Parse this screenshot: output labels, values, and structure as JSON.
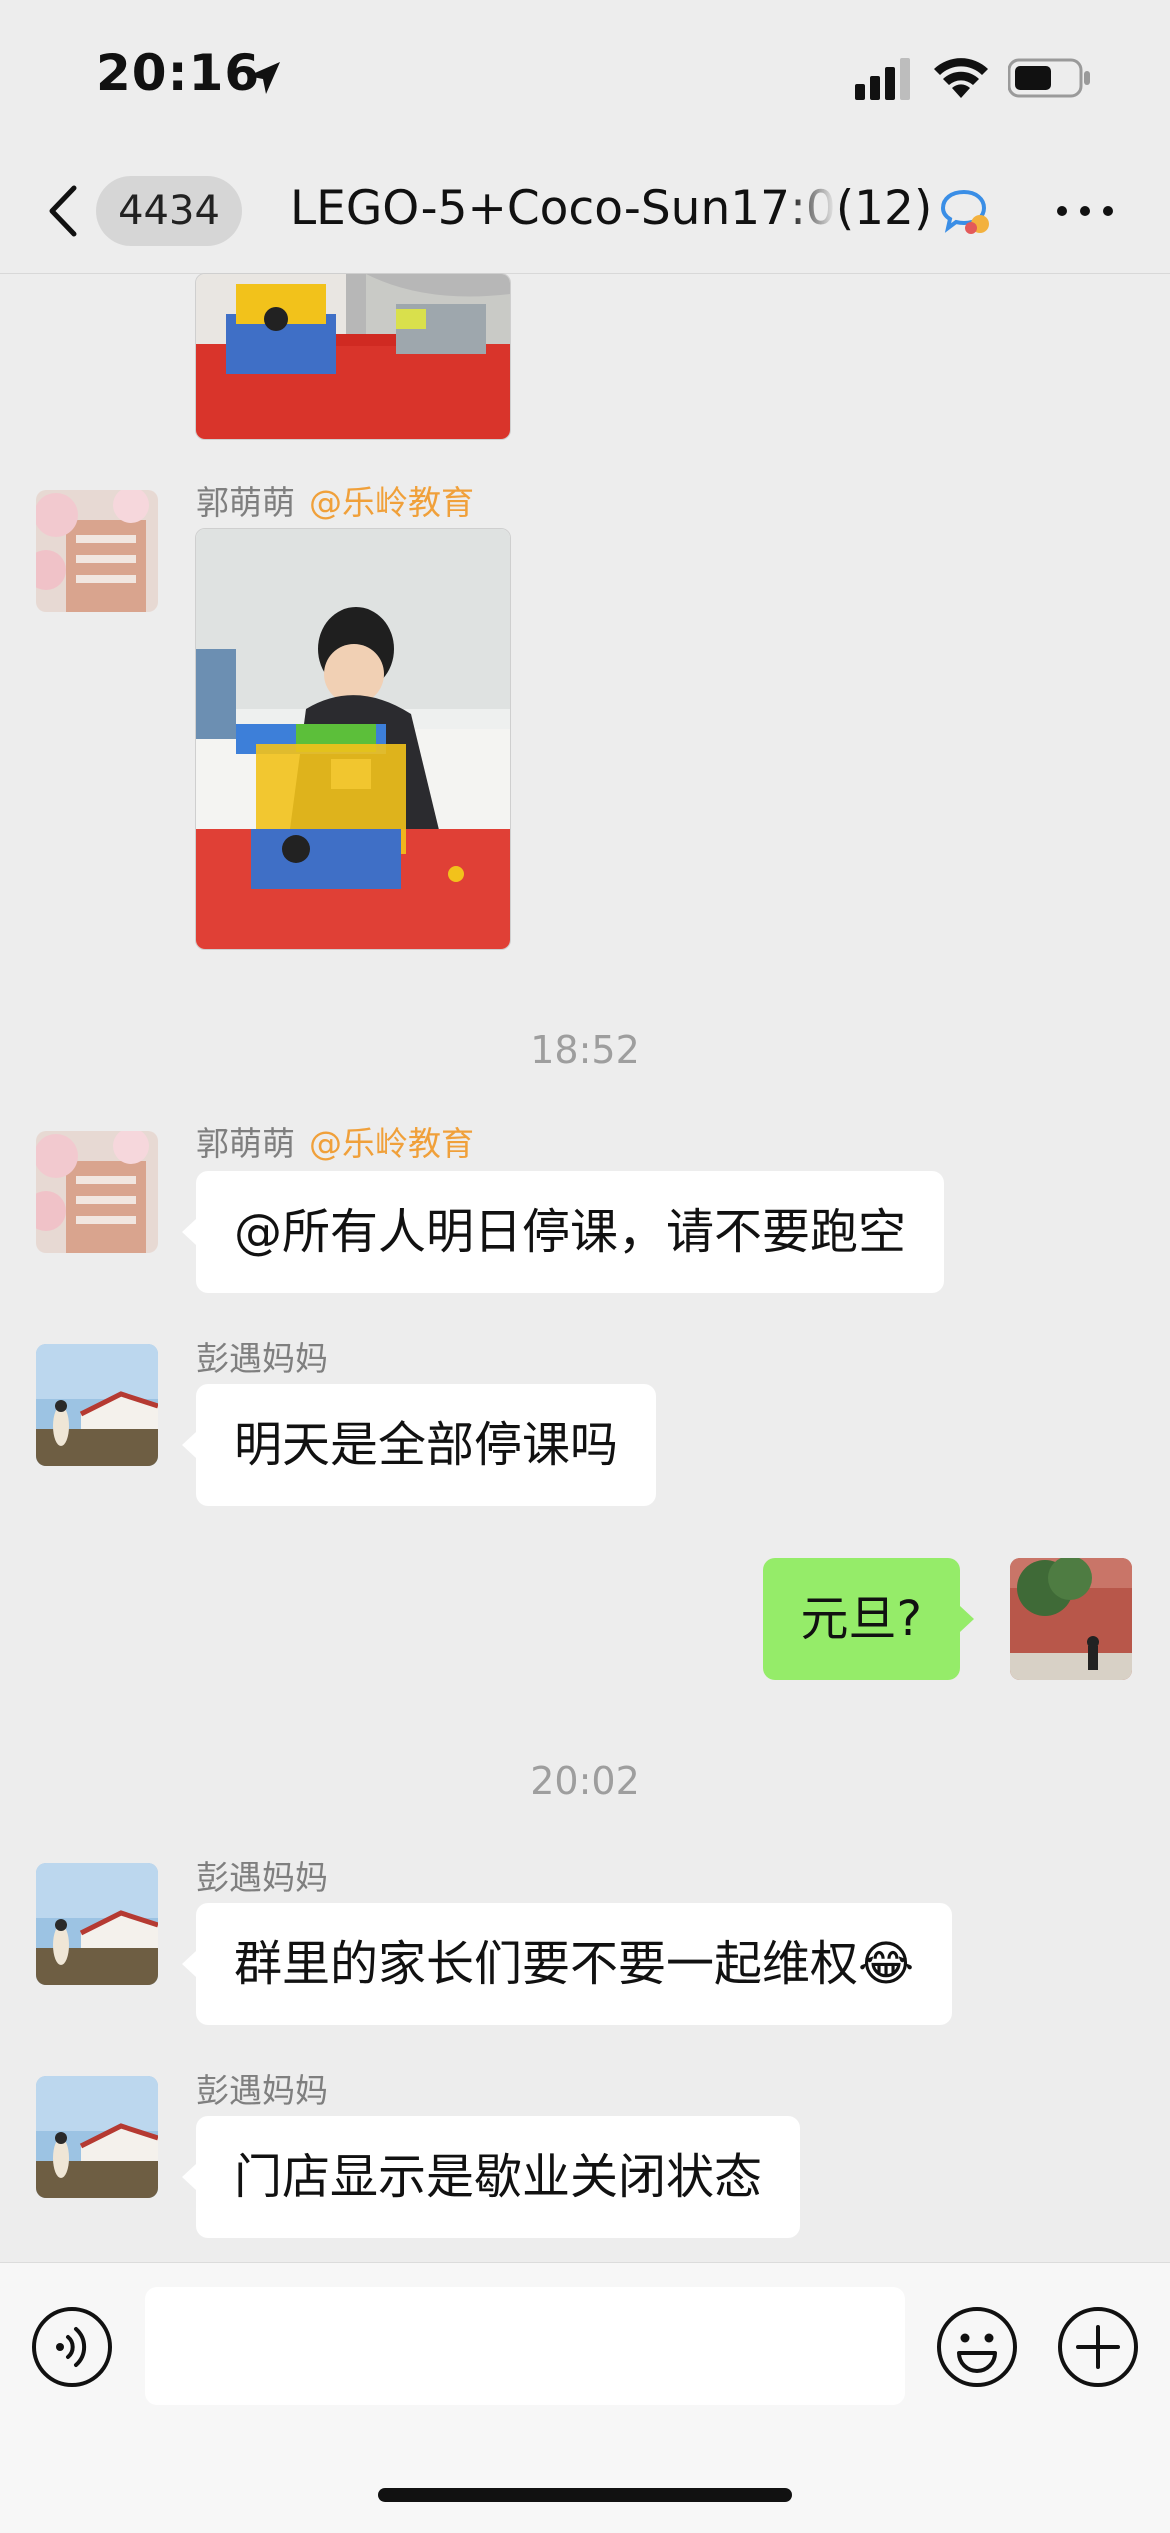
{
  "status_bar": {
    "time": "20:16",
    "icons": [
      "location-arrow-icon",
      "cellular-signal-icon",
      "wifi-icon",
      "battery-icon"
    ]
  },
  "nav": {
    "unread_count": "4434",
    "title": "LEGO-5+Coco-Sun17:0",
    "member_count": "(12)",
    "icons": [
      "back-chevron-icon",
      "group-chat-icon",
      "more-dots-icon"
    ]
  },
  "messages": [
    {
      "type": "image",
      "side": "left",
      "description_icon": "lego-photo"
    },
    {
      "type": "image",
      "side": "left",
      "sender": "郭萌萌",
      "sender_tag": "@乐岭教育"
    },
    {
      "type": "timestamp",
      "text": "18:52"
    },
    {
      "type": "text",
      "side": "left",
      "sender": "郭萌萌",
      "sender_tag": "@乐岭教育",
      "text": "@所有人明日停课，请不要跑空"
    },
    {
      "type": "text",
      "side": "left",
      "sender": "彭遇妈妈",
      "text": "明天是全部停课吗"
    },
    {
      "type": "text",
      "side": "right",
      "text": "元旦?"
    },
    {
      "type": "timestamp",
      "text": "20:02"
    },
    {
      "type": "text",
      "side": "left",
      "sender": "彭遇妈妈",
      "text": "群里的家长们要不要一起维权",
      "emoji": "😂"
    },
    {
      "type": "text",
      "side": "left",
      "sender": "彭遇妈妈",
      "text": "门店显示是歇业关闭状态"
    }
  ],
  "input": {
    "value": "",
    "icons": [
      "voice-icon",
      "emoji-icon",
      "plus-icon"
    ]
  },
  "colors": {
    "background": "#ededed",
    "my_bubble": "#95ec69",
    "other_bubble": "#ffffff",
    "sender_tag": "#f0a03a"
  }
}
